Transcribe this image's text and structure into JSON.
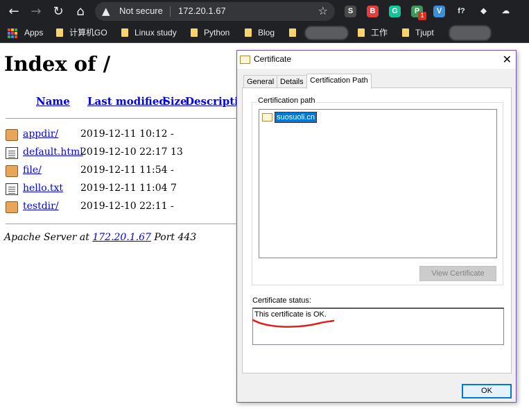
{
  "browser": {
    "security_status": "Not secure",
    "url": "172.20.1.67",
    "extensions": [
      {
        "name": "s-extension-icon",
        "glyph": "S",
        "color": "#4a4a4a"
      },
      {
        "name": "red-extension-icon",
        "glyph": "B",
        "color": "#e0403c"
      },
      {
        "name": "grammarly-icon",
        "glyph": "G",
        "color": "#15c39a"
      },
      {
        "name": "green-extension-icon",
        "glyph": "P",
        "color": "#3c9a5a"
      },
      {
        "name": "blue-extension-icon",
        "glyph": "V",
        "color": "#3a8fd8"
      },
      {
        "name": "formula-extension-icon",
        "glyph": "f?",
        "color": "#202124"
      },
      {
        "name": "cube-extension-icon",
        "glyph": "◆",
        "color": "#202124"
      },
      {
        "name": "cloud-extension-icon",
        "glyph": "☁",
        "color": "#202124"
      }
    ],
    "extension_badge": "1",
    "bookmarks": [
      {
        "label": "Apps"
      },
      {
        "label": "计算机GO"
      },
      {
        "label": "Linux study"
      },
      {
        "label": "Python"
      },
      {
        "label": "Blog"
      },
      {
        "label": "工作"
      },
      {
        "label": "Tjupt"
      }
    ]
  },
  "page": {
    "title": "Index of /",
    "columns": [
      "Name",
      "Last modified",
      "Size",
      "Description"
    ],
    "rows": [
      {
        "type": "folder",
        "name": "appdir/",
        "modified": "2019-12-11 10:12",
        "size": "-"
      },
      {
        "type": "file",
        "name": "default.html",
        "modified": "2019-12-10 22:17",
        "size": "13"
      },
      {
        "type": "folder",
        "name": "file/",
        "modified": "2019-12-11 11:54",
        "size": "-"
      },
      {
        "type": "file",
        "name": "hello.txt",
        "modified": "2019-12-11 11:04",
        "size": "7"
      },
      {
        "type": "folder",
        "name": "testdir/",
        "modified": "2019-12-10 22:11",
        "size": "-"
      }
    ],
    "address_prefix": "Apache Server at",
    "address_host": "172.20.1.67",
    "address_suffix": "Port 443"
  },
  "dialog": {
    "title": "Certificate",
    "tabs": [
      "General",
      "Details",
      "Certification Path"
    ],
    "active_tab": "Certification Path",
    "path_label": "Certification path",
    "path_node": "suosuoli.cn",
    "view_button": "View Certificate",
    "status_label": "Certificate status:",
    "status_text": "This certificate is OK.",
    "ok_button": "OK"
  }
}
